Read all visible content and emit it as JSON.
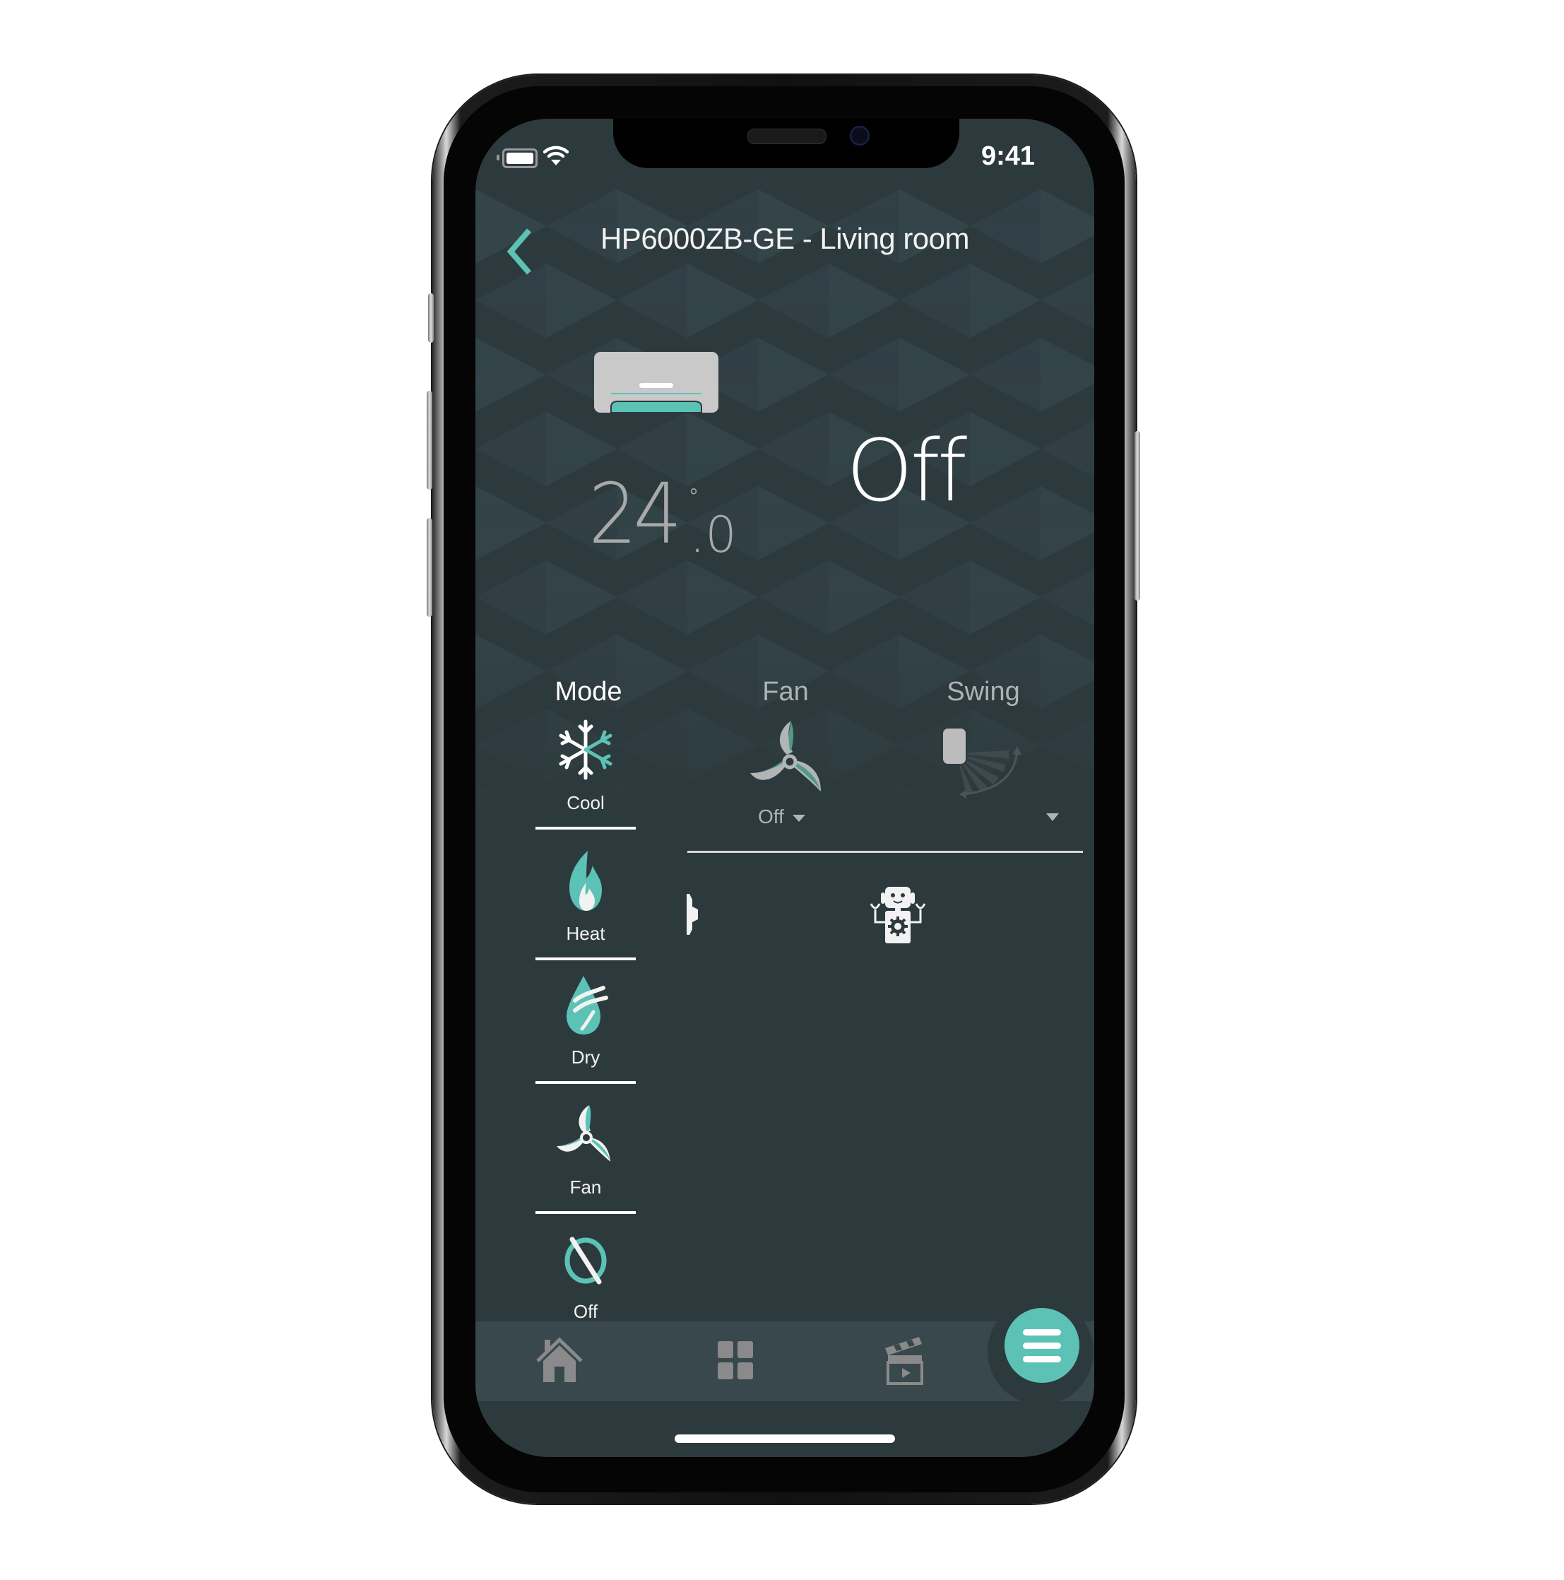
{
  "status_bar": {
    "time": "9:41",
    "battery_icon": "battery-icon",
    "wifi_icon": "wifi-icon"
  },
  "header": {
    "back_icon": "chevron-left-icon",
    "title": "HP6000ZB-GE - Living room"
  },
  "device": {
    "icon": "air-conditioner-icon",
    "setpoint_integer": "24",
    "setpoint_decimal": "0",
    "degree_symbol": "°",
    "state": "Off"
  },
  "controls": {
    "mode": {
      "label": "Mode",
      "items": [
        {
          "label": "Cool",
          "icon": "snowflake-icon"
        },
        {
          "label": "Heat",
          "icon": "flame-icon"
        },
        {
          "label": "Dry",
          "icon": "water-drop-icon"
        },
        {
          "label": "Fan",
          "icon": "fan-icon"
        },
        {
          "label": "Off",
          "icon": "power-off-icon"
        }
      ]
    },
    "fan": {
      "label": "Fan",
      "value": "Off",
      "icon": "fan-icon"
    },
    "swing": {
      "label": "Swing",
      "value": "",
      "icon": "swing-icon"
    }
  },
  "extras": {
    "robot_icon": "robot-automation-icon"
  },
  "bottom_nav": {
    "items": [
      {
        "name": "home",
        "icon": "home-icon"
      },
      {
        "name": "dashboard",
        "icon": "grid-icon"
      },
      {
        "name": "scenes",
        "icon": "clapperboard-icon"
      }
    ],
    "fab_icon": "menu-icon"
  },
  "colors": {
    "accent": "#5cc2b6",
    "background": "#2d3a3d",
    "nav_background": "#38484c",
    "text_primary": "#ffffff",
    "text_muted": "#aeb2b2"
  }
}
